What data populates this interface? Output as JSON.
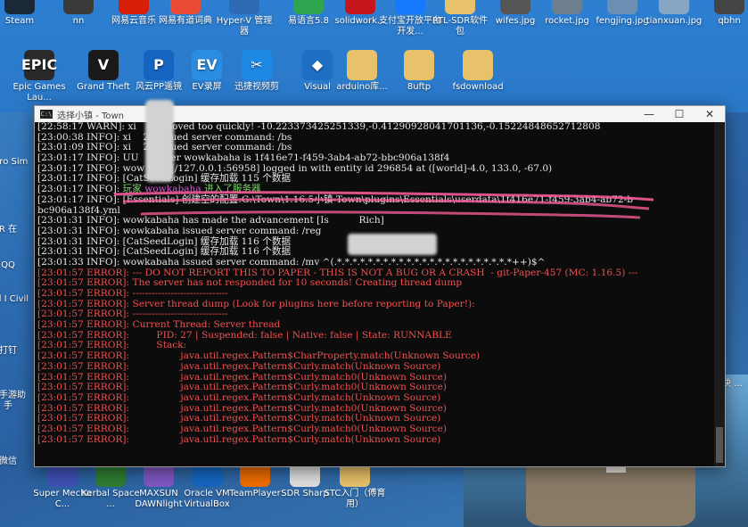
{
  "desktop_top": [
    {
      "label": "Steam",
      "icon": "steam-icon",
      "color": "#1b2838"
    },
    {
      "label": "nn",
      "icon": "app-icon",
      "color": "#3a3a3a"
    },
    {
      "label": "网易云音乐",
      "icon": "netease-music-icon",
      "color": "#d81e06"
    },
    {
      "label": "网易有道词典",
      "icon": "youdao-icon",
      "color": "#e94b35"
    },
    {
      "label": "Hyper-V 管理器",
      "icon": "hyperv-icon",
      "color": "#2d6bb5"
    },
    {
      "label": "易语言5.8",
      "icon": "eyuyan-icon",
      "color": "#2fa44f"
    },
    {
      "label": "solidwork...",
      "icon": "solidworks-icon",
      "color": "#c4161c"
    },
    {
      "label": "支付宝开放平台开发...",
      "icon": "alipay-icon",
      "color": "#1677ff"
    },
    {
      "label": "RTL-SDR软件包",
      "icon": "folder-icon",
      "color": "#e8c26a"
    },
    {
      "label": "wifes.jpg",
      "icon": "image-icon",
      "color": "#555"
    },
    {
      "label": "rocket.jpg",
      "icon": "image-icon",
      "color": "#6e7f8f"
    },
    {
      "label": "fengjing.jpg",
      "icon": "image-icon",
      "color": "#6a8fb3"
    },
    {
      "label": "tianxuan.jpg",
      "icon": "image-icon",
      "color": "#88a5c4"
    },
    {
      "label": "qbhn",
      "icon": "image-icon",
      "color": "#444"
    }
  ],
  "desktop_row2": [
    {
      "label": "Epic Games Lau...",
      "icon": "epic-icon",
      "color": "#2a2a2a",
      "glyph": "EPIC"
    },
    {
      "label": "Grand Theft",
      "icon": "gta-icon",
      "color": "#1a1a1a",
      "glyph": "V"
    },
    {
      "label": "风云PP遥镜",
      "icon": "pp-icon",
      "color": "#1565c0",
      "glyph": "P"
    },
    {
      "label": "EV录屏",
      "icon": "ev-icon",
      "color": "#2b8de0",
      "glyph": "EV"
    },
    {
      "label": "迅捷视频剪",
      "icon": "video-editor-icon",
      "color": "#1e88e5",
      "glyph": "✂"
    },
    {
      "label": "Visual",
      "icon": "vscode-icon",
      "color": "#1e6fc4",
      "glyph": "◆"
    },
    {
      "label": "arduino库...",
      "icon": "folder-icon",
      "color": "#e8c26a",
      "glyph": ""
    },
    {
      "label": "8uftp",
      "icon": "folder-icon",
      "color": "#e8c26a",
      "glyph": ""
    },
    {
      "label": "fsdownload",
      "icon": "folder-icon",
      "color": "#e8c26a",
      "glyph": ""
    }
  ],
  "desktop_left": [
    {
      "label": "Euro Sim"
    },
    {
      "label": "R 在"
    },
    {
      "label": "QQ"
    },
    {
      "label": "Sid I Civil"
    },
    {
      "label": "打钉"
    },
    {
      "label": "讯手游助手"
    },
    {
      "label": "微信"
    }
  ],
  "desktop_bottom": [
    {
      "label": "Super Mecha C...",
      "icon": "mecha-icon",
      "color": "#3f51b5"
    },
    {
      "label": "Kerbal Space ...",
      "icon": "kerbal-icon",
      "color": "#2e7d32"
    },
    {
      "label": "MAXSUN DAWNlight",
      "icon": "maxsun-icon",
      "color": "#7e57c2"
    },
    {
      "label": "Oracle VM VirtualBox",
      "icon": "virtualbox-icon",
      "color": "#1565c0"
    },
    {
      "label": "TeamPlayer",
      "icon": "teamplayer-icon",
      "color": "#ef6c00"
    },
    {
      "label": "SDR Sharp",
      "icon": "file-icon",
      "color": "#e0e0e0"
    },
    {
      "label": "STC入门（傅育用）",
      "icon": "folder-icon",
      "color": "#e8c26a"
    }
  ],
  "right_side_text": "更一 - 快 ...",
  "window": {
    "title": "选择小镇 - Town",
    "minimize": "—",
    "maximize": "☐",
    "close": "✕"
  },
  "console_lines": [
    {
      "text": "[22:58:17 WARN]: xi    20 moved too quickly! -10.223373425251339,-0.41290928041701136,-0.15224848652712808",
      "color": "w"
    },
    {
      "text": "[23:00:38 INFO]: xi    20 issued server command: /bs",
      "color": "w"
    },
    {
      "text": "[23:01:09 INFO]: xi    20 issued server command: /bs",
      "color": "w"
    },
    {
      "text": "[23:01:17 INFO]: UU    player wowkabaha is 1f416e71-f459-3ab4-ab72-bbc906a138f4",
      "color": "w"
    },
    {
      "text": "[23:01:17 INFO]: wow   aha[/127.0.0.1:56958] logged in with entity id 296854 at ([world]-4.0, 133.0, -67.0)",
      "color": "w"
    },
    {
      "text": "[23:01:17 INFO]: [CatSeedLogin] 缓存加载 115 个数据",
      "color": "w"
    },
    {
      "segments": [
        {
          "t": "[23:01:17 INFO]: ",
          "c": "w"
        },
        {
          "t": "玩家 ",
          "c": "g"
        },
        {
          "t": "wowkabaha",
          "c": "m"
        },
        {
          "t": " 进入了服务器",
          "c": "g"
        }
      ]
    },
    {
      "text": "[23:01:17 INFO]: [Essentials] 创建空的配置:G:\\Town\\1.16.5小镇-Town\\plugins\\Essentials\\userdata\\1f416e71-f459-3ab4-ab72-b",
      "color": "w"
    },
    {
      "text": "bc906a138f4.yml",
      "color": "w"
    },
    {
      "text": "[23:01:31 INFO]: wowkabaha has made the advancement [Is          Rich]",
      "color": "w"
    },
    {
      "text": "[23:01:31 INFO]: wowkabaha issued server command: /reg",
      "color": "w"
    },
    {
      "text": "[23:01:31 INFO]: [CatSeedLogin] 缓存加载 116 个数据",
      "color": "w"
    },
    {
      "text": "[23:01:31 INFO]: [CatSeedLogin] 缓存加载 116 个数据",
      "color": "w"
    },
    {
      "text": "[23:01:33 INFO]: wowkabaha issued server command: /mv ^(.*.*.*.*.*.*.*.*.*.*.*.*.*.*.*.*.*.*.*.*.*.*.*++)$^",
      "color": "w"
    },
    {
      "text": "[23:01:57 ERROR]: --- DO NOT REPORT THIS TO PAPER - THIS IS NOT A BUG OR A CRASH  - git-Paper-457 (MC: 1.16.5) ---",
      "color": "r"
    },
    {
      "text": "[23:01:57 ERROR]: The server has not responded for 10 seconds! Creating thread dump",
      "color": "r"
    },
    {
      "text": "[23:01:57 ERROR]: ------------------------------",
      "color": "r"
    },
    {
      "text": "[23:01:57 ERROR]: Server thread dump (Look for plugins here before reporting to Paper!):",
      "color": "r"
    },
    {
      "text": "[23:01:57 ERROR]: ------------------------------",
      "color": "r"
    },
    {
      "text": "[23:01:57 ERROR]: Current Thread: Server thread",
      "color": "r"
    },
    {
      "text": "[23:01:57 ERROR]:         PID: 27 | Suspended: false | Native: false | State: RUNNABLE",
      "color": "r"
    },
    {
      "text": "[23:01:57 ERROR]:         Stack:",
      "color": "r"
    },
    {
      "text": "[23:01:57 ERROR]:                 java.util.regex.Pattern$CharProperty.match(Unknown Source)",
      "color": "r"
    },
    {
      "text": "[23:01:57 ERROR]:                 java.util.regex.Pattern$Curly.match(Unknown Source)",
      "color": "r"
    },
    {
      "text": "[23:01:57 ERROR]:                 java.util.regex.Pattern$Curly.match0(Unknown Source)",
      "color": "r"
    },
    {
      "text": "[23:01:57 ERROR]:                 java.util.regex.Pattern$Curly.match0(Unknown Source)",
      "color": "r"
    },
    {
      "text": "[23:01:57 ERROR]:                 java.util.regex.Pattern$Curly.match(Unknown Source)",
      "color": "r"
    },
    {
      "text": "[23:01:57 ERROR]:                 java.util.regex.Pattern$Curly.match0(Unknown Source)",
      "color": "r"
    },
    {
      "text": "[23:01:57 ERROR]:                 java.util.regex.Pattern$Curly.match(Unknown Source)",
      "color": "r"
    },
    {
      "text": "[23:01:57 ERROR]:                 java.util.regex.Pattern$Curly.match0(Unknown Source)",
      "color": "r"
    },
    {
      "text": "[23:01:57 ERROR]:                 java.util.regex.Pattern$Curly.match(Unknown Source)",
      "color": "r"
    }
  ],
  "colors": {
    "console_bg": "#0c0c0c",
    "text_white": "#e6e6e6",
    "text_green": "#7cd16a",
    "text_magenta": "#d35bd3",
    "text_red": "#f25050",
    "annotation_pink": "#ff5f9e"
  }
}
